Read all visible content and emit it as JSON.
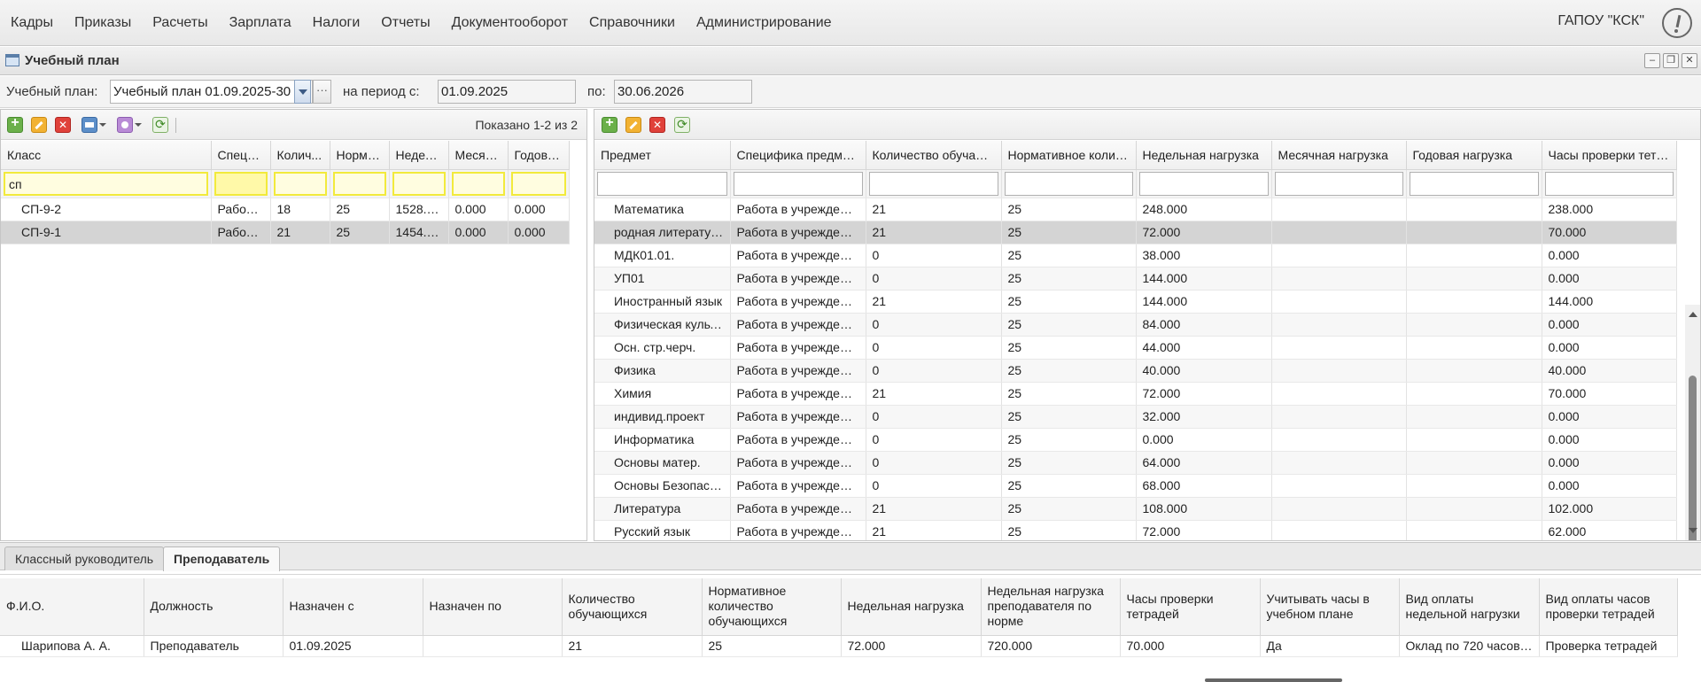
{
  "menu": [
    "Кадры",
    "Приказы",
    "Расчеты",
    "Зарплата",
    "Налоги",
    "Отчеты",
    "Документооборот",
    "Справочники",
    "Администрирование"
  ],
  "org_name": "ГАПОУ \"КСК\"",
  "window": {
    "title": "Учебный план"
  },
  "filter": {
    "plan_label": "Учебный план:",
    "plan_value": "Учебный план 01.09.2025-30",
    "period_label": "на период с:",
    "period_from": "01.09.2025",
    "to_label": "по:",
    "period_to": "30.06.2026"
  },
  "left": {
    "shown_text": "Показано 1-2 из 2",
    "columns": [
      "Класс",
      "Специ...",
      "Колич...",
      "Норма...",
      "Недел...",
      "Месяч...",
      "Годова..."
    ],
    "filter_value": "сп",
    "rows": [
      [
        "СП-9-2",
        "Работа...",
        "18",
        "25",
        "1528.0...",
        "0.000",
        "0.000"
      ],
      [
        "СП-9-1",
        "Работа...",
        "21",
        "25",
        "1454.0...",
        "0.000",
        "0.000"
      ]
    ],
    "selected_row": 1
  },
  "right": {
    "columns": [
      "Предмет",
      "Специфика предмета",
      "Количество обучаю...",
      "Нормативное колич...",
      "Недельная нагрузка",
      "Месячная нагрузка",
      "Годовая нагрузка",
      "Часы проверки тетр..."
    ],
    "rows": [
      [
        "Математика",
        "Работа в учреждени...",
        "21",
        "25",
        "248.000",
        "",
        "",
        "238.000"
      ],
      [
        "родная литература",
        "Работа в учреждени...",
        "21",
        "25",
        "72.000",
        "",
        "",
        "70.000"
      ],
      [
        "МДК01.01.",
        "Работа в учреждени...",
        "0",
        "25",
        "38.000",
        "",
        "",
        "0.000"
      ],
      [
        "УП01",
        "Работа в учреждени...",
        "0",
        "25",
        "144.000",
        "",
        "",
        "0.000"
      ],
      [
        "Иностранный язык",
        "Работа в учреждени...",
        "21",
        "25",
        "144.000",
        "",
        "",
        "144.000"
      ],
      [
        "Физическая культ...",
        "Работа в учреждени...",
        "0",
        "25",
        "84.000",
        "",
        "",
        "0.000"
      ],
      [
        "Осн. стр.черч.",
        "Работа в учреждени...",
        "0",
        "25",
        "44.000",
        "",
        "",
        "0.000"
      ],
      [
        "Физика",
        "Работа в учреждени...",
        "0",
        "25",
        "40.000",
        "",
        "",
        "40.000"
      ],
      [
        "Химия",
        "Работа в учреждени...",
        "21",
        "25",
        "72.000",
        "",
        "",
        "70.000"
      ],
      [
        "индивид.проект",
        "Работа в учреждени...",
        "0",
        "25",
        "32.000",
        "",
        "",
        "0.000"
      ],
      [
        "Информатика",
        "Работа в учреждени...",
        "0",
        "25",
        "0.000",
        "",
        "",
        "0.000"
      ],
      [
        "Основы матер.",
        "Работа в учреждени...",
        "0",
        "25",
        "64.000",
        "",
        "",
        "0.000"
      ],
      [
        "Основы Безопасн...",
        "Работа в учреждени...",
        "0",
        "25",
        "68.000",
        "",
        "",
        "0.000"
      ],
      [
        "Литература",
        "Работа в учреждени...",
        "21",
        "25",
        "108.000",
        "",
        "",
        "102.000"
      ],
      [
        "Русский язык",
        "Работа в учреждени...",
        "21",
        "25",
        "72.000",
        "",
        "",
        "62.000"
      ]
    ],
    "selected_row": 1
  },
  "tabs": [
    {
      "label": "Классный руководитель",
      "active": false
    },
    {
      "label": "Преподаватель",
      "active": true
    }
  ],
  "bottom": {
    "columns": [
      "Ф.И.О.",
      "Должность",
      "Назначен с",
      "Назначен по",
      "Количество обучающихся",
      "Нормативное количество обучающихся",
      "Недельная нагрузка",
      "Недельная нагрузка преподавателя по норме",
      "Часы проверки тетрадей",
      "Учитывать часы в учебном плане",
      "Вид оплаты недельной нагрузки",
      "Вид оплаты часов проверки тетрадей"
    ],
    "rows": [
      [
        "Шарипова А. А.",
        "Преподаватель",
        "01.09.2025",
        "",
        "21",
        "25",
        "72.000",
        "720.000",
        "70.000",
        "Да",
        "Оклад по 720 часово...",
        "Проверка тетрадей"
      ]
    ]
  }
}
